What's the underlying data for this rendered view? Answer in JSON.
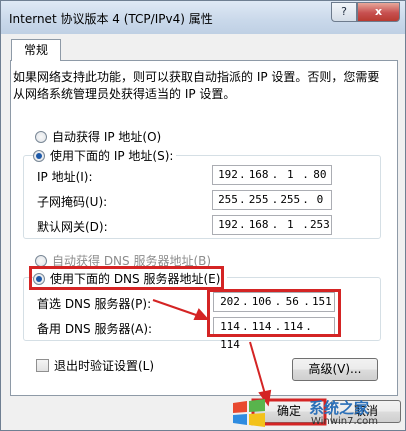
{
  "window": {
    "title": "Internet 协议版本 4 (TCP/IPv4) 属性",
    "help_label": "?",
    "close_label": "x"
  },
  "tab": {
    "label": "常规"
  },
  "description": "如果网络支持此功能，则可以获取自动指派的 IP 设置。否则，您需要从网络系统管理员处获得适当的 IP 设置。",
  "ip": {
    "auto_label": "自动获得 IP 地址(O)",
    "manual_label": "使用下面的 IP 地址(S):",
    "address_label": "IP 地址(I):",
    "address": [
      "192",
      "168",
      "1",
      "80"
    ],
    "mask_label": "子网掩码(U):",
    "mask": [
      "255",
      "255",
      "255",
      "0"
    ],
    "gateway_label": "默认网关(D):",
    "gateway": [
      "192",
      "168",
      "1",
      "253"
    ]
  },
  "dns": {
    "auto_label": "自动获得 DNS 服务器地址(B)",
    "manual_label": "使用下面的 DNS 服务器地址(E):",
    "preferred_label": "首选 DNS 服务器(P):",
    "preferred": [
      "202",
      "106",
      "56",
      "151"
    ],
    "alternate_label": "备用 DNS 服务器(A):",
    "alternate": [
      "114",
      "114",
      "114",
      "114"
    ]
  },
  "validate_label": "退出时验证设置(L)",
  "advanced_label": "高级(V)...",
  "ok_label": "确定",
  "cancel_label": "取消",
  "watermark": {
    "brand": "系统之家",
    "url": "Winwin7.com"
  },
  "colors": {
    "annotation": "#d42424",
    "radio_selected": "#1c58a8"
  }
}
